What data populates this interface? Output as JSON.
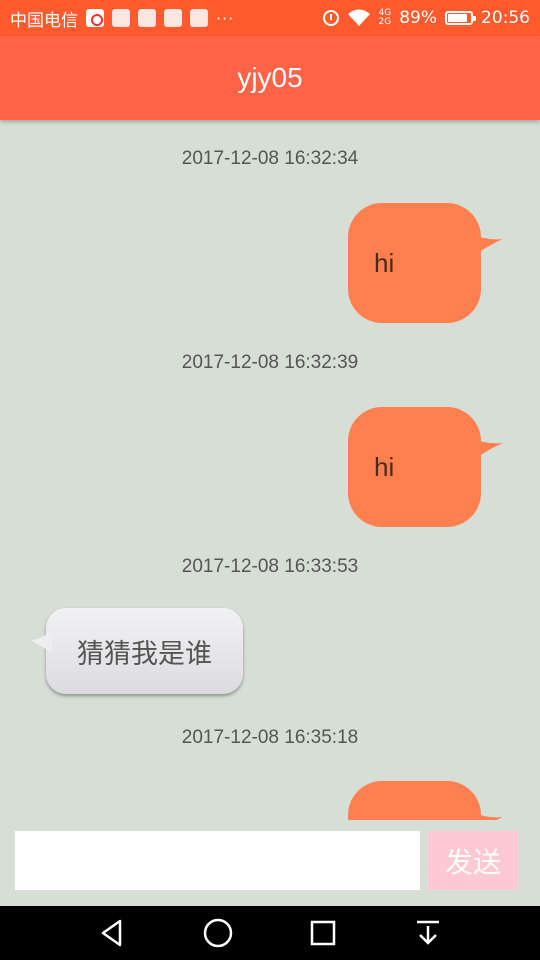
{
  "status_bar": {
    "carrier": "中国电信",
    "overflow_indicator": "···",
    "network_top": "4G",
    "network_bottom": "2G",
    "battery_percent": "89%",
    "battery_level": 0.89,
    "time": "20:56"
  },
  "app_bar": {
    "title": "yjy05"
  },
  "messages": [
    {
      "timestamp": "2017-12-08 16:32:34",
      "direction": "outgoing",
      "text": "hi"
    },
    {
      "timestamp": "2017-12-08 16:32:39",
      "direction": "outgoing",
      "text": "hi"
    },
    {
      "timestamp": "2017-12-08 16:33:53",
      "direction": "incoming",
      "text": "猜猜我是谁"
    },
    {
      "timestamp": "2017-12-08 16:35:18",
      "direction": "outgoing",
      "text": ""
    }
  ],
  "input_bar": {
    "value": "",
    "send_label": "发送"
  },
  "colors": {
    "status_bar": "#ff5a2e",
    "app_bar": "#ff6347",
    "chat_background": "#d6ded6",
    "outgoing_bubble": "#ff7f4f",
    "send_button": "#ffc8d2"
  },
  "nav_bar": {
    "icons": [
      "back-icon",
      "home-icon",
      "recents-icon",
      "notification-pull-icon"
    ]
  }
}
